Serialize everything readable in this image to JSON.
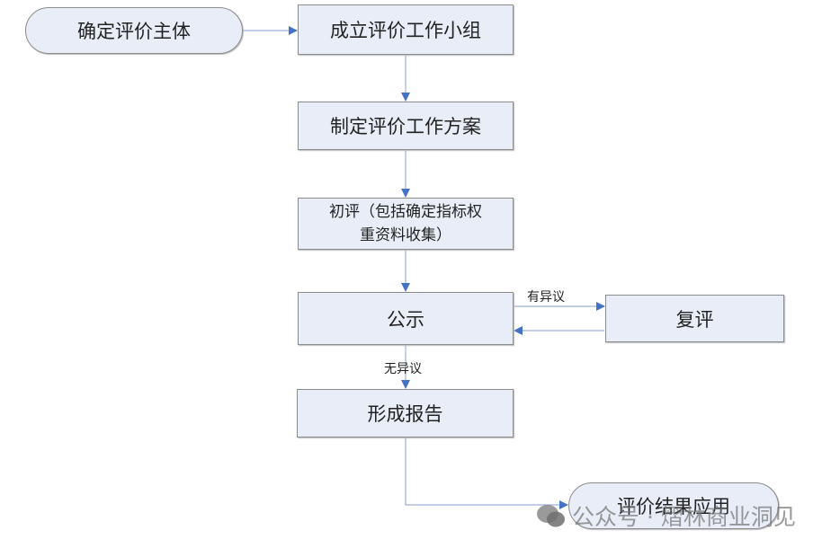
{
  "nodes": {
    "start": "确定评价主体",
    "team": "成立评价工作小组",
    "plan": "制定评价工作方案",
    "initial_line1": "初评（包括确定指标权",
    "initial_line2": "重资料收集）",
    "publicize": "公示",
    "review": "复评",
    "report": "形成报告",
    "end": "评价结果应用"
  },
  "edge_labels": {
    "objection": "有异议",
    "no_objection": "无异议"
  },
  "watermark": "公众号 · 熠林商业洞见",
  "colors": {
    "arrow": "#4472c4",
    "line": "#9fb1d6",
    "fill": "#e8edf7"
  }
}
